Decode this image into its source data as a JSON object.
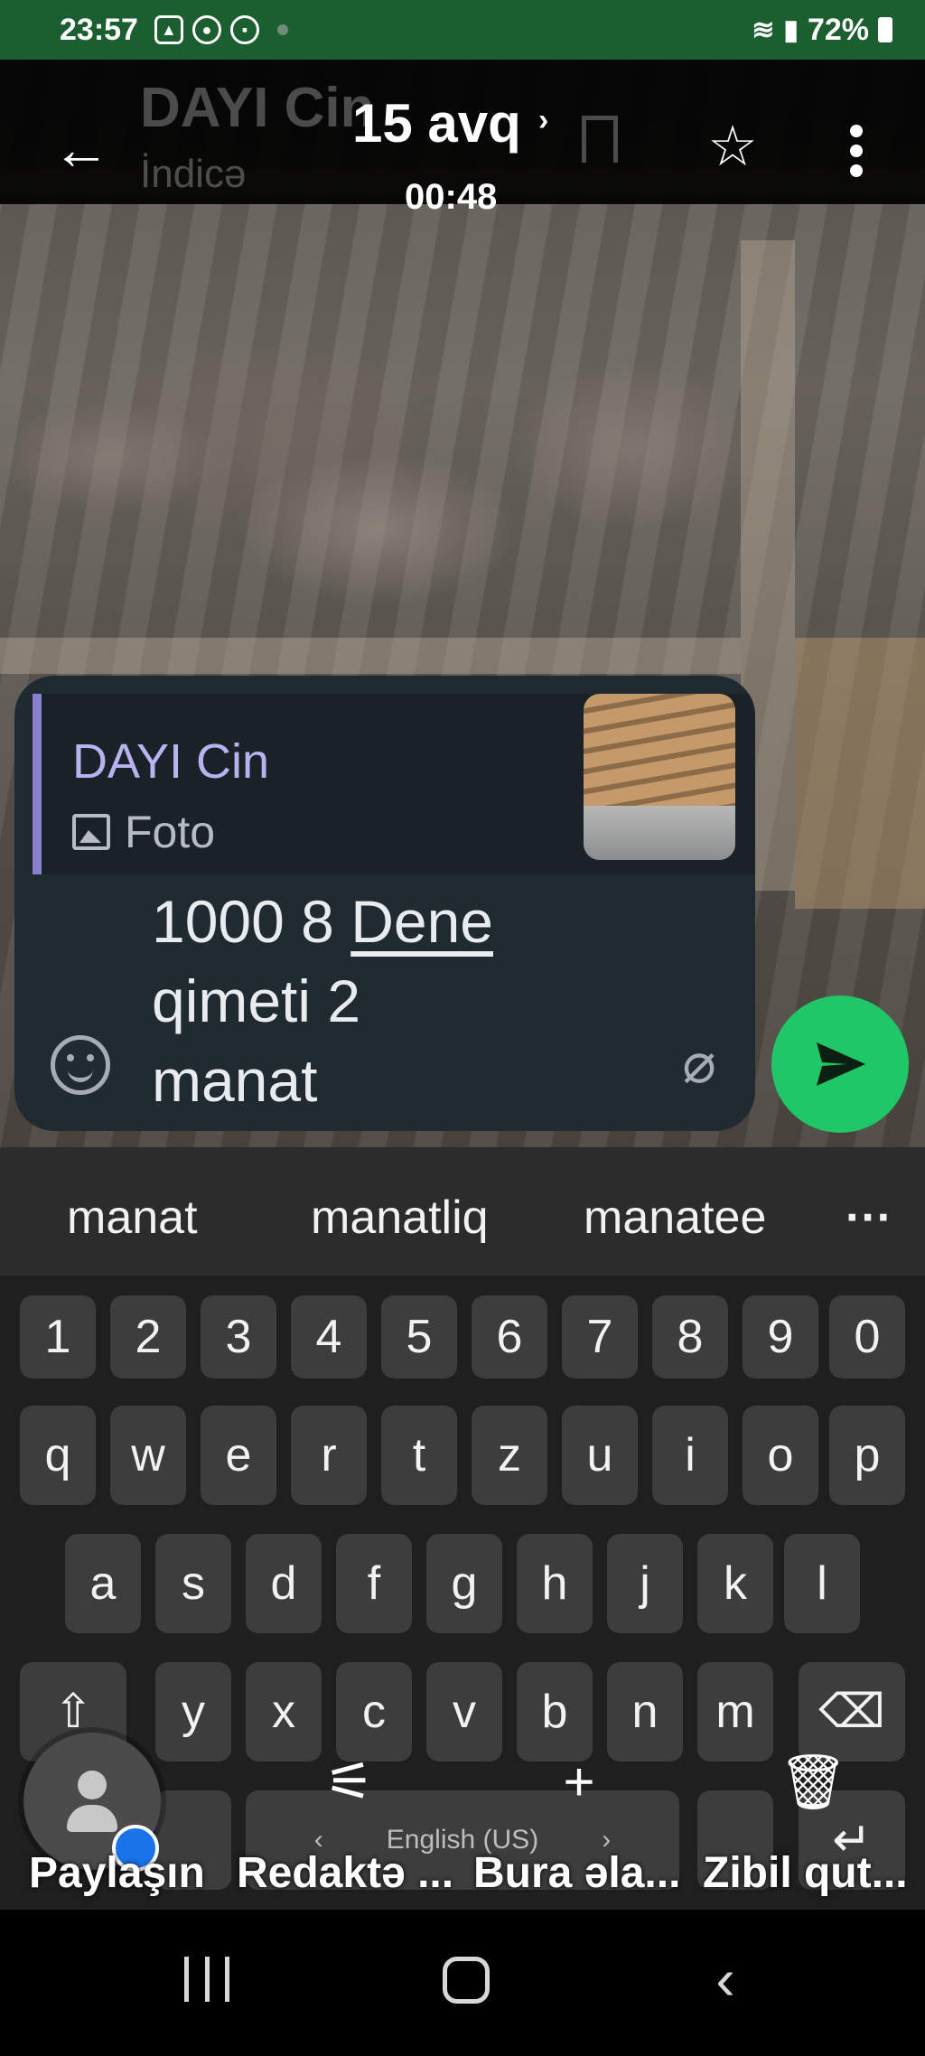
{
  "status_bar": {
    "time": "23:57",
    "battery": "72%",
    "icons": [
      "gallery-icon",
      "chat-bubble-icon",
      "media-icon",
      "wifi-icon",
      "signal-icon",
      "battery-icon"
    ]
  },
  "viewer": {
    "ghost_name": "DAYI Cin",
    "ghost_subtitle": "İndicə",
    "date": "15 avq",
    "date_chevron": "›",
    "time": "00:48"
  },
  "composer": {
    "reply_name": "DAYI Cin",
    "reply_type": "Foto",
    "message_part1": "1000 8 ",
    "message_underlined": "Dene",
    "message_part2": "qimeti 2 manat"
  },
  "keyboard": {
    "suggestions": [
      "manat",
      "manatliq",
      "manatee",
      "···"
    ],
    "row_numbers": [
      "1",
      "2",
      "3",
      "4",
      "5",
      "6",
      "7",
      "8",
      "9",
      "0"
    ],
    "row_top": [
      "q",
      "w",
      "e",
      "r",
      "t",
      "z",
      "u",
      "i",
      "o",
      "p"
    ],
    "row_middle": [
      "a",
      "s",
      "d",
      "f",
      "g",
      "h",
      "j",
      "k",
      "l"
    ],
    "row_bottom": [
      "y",
      "x",
      "c",
      "v",
      "b",
      "n",
      "m"
    ],
    "language": "English (US)",
    "lang_left": "‹",
    "lang_right": "›"
  },
  "action_bar": {
    "share": "Paylaşın",
    "edit": "Redaktə ...",
    "add": "Bura əla...",
    "trash": "Zibil qut..."
  },
  "colors": {
    "status_bar_bg": "#1b5e30",
    "send_button": "#1fc766",
    "reply_accent": "#8b7fd0",
    "composer_bg": "#202a31"
  }
}
